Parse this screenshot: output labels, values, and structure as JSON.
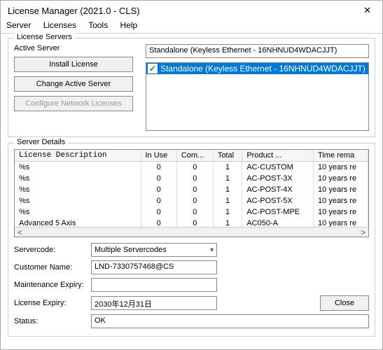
{
  "window": {
    "title": "License Manager (2021.0 - CLS)"
  },
  "menu": {
    "server": "Server",
    "licenses": "Licenses",
    "tools": "Tools",
    "help": "Help"
  },
  "servers_group": {
    "title": "License Servers",
    "active_label": "Active Server",
    "active_value": "Standalone (Keyless Ethernet - 16NHNUD4WDACJJT)",
    "install_btn": "Install License",
    "change_btn": "Change Active Server",
    "config_btn": "Configure Network Licenses",
    "list_item": "Standalone (Keyless Ethernet - 16NHNUD4WDACJJT)"
  },
  "details_group": {
    "title": "Server Details",
    "headers": {
      "desc": "License Description",
      "inuse": "In Use",
      "com": "Com...",
      "total": "Total",
      "product": "Product ...",
      "time": "Time rema"
    },
    "rows": [
      {
        "desc": "%s",
        "inuse": "0",
        "com": "0",
        "total": "1",
        "product": "AC-CUSTOM",
        "time": "10 years re"
      },
      {
        "desc": "%s",
        "inuse": "0",
        "com": "0",
        "total": "1",
        "product": "AC-POST-3X",
        "time": "10 years re"
      },
      {
        "desc": "%s",
        "inuse": "0",
        "com": "0",
        "total": "1",
        "product": "AC-POST-4X",
        "time": "10 years re"
      },
      {
        "desc": "%s",
        "inuse": "0",
        "com": "0",
        "total": "1",
        "product": "AC-POST-5X",
        "time": "10 years re"
      },
      {
        "desc": "%s",
        "inuse": "0",
        "com": "0",
        "total": "1",
        "product": "AC-POST-MPE",
        "time": "10 years re"
      },
      {
        "desc": "Advanced 5 Axis",
        "inuse": "0",
        "com": "0",
        "total": "1",
        "product": "AC050-A",
        "time": "10 years re"
      }
    ]
  },
  "form": {
    "servercode_label": "Servercode:",
    "servercode_value": "Multiple Servercodes",
    "customer_label": "Customer Name:",
    "customer_value": "LND-7330757468@CS",
    "maint_label": "Maintenance Expiry:",
    "maint_value": "",
    "lic_label": "License Expiry:",
    "lic_value": "2030年12月31日",
    "status_label": "Status:",
    "status_value": "OK",
    "close_btn": "Close"
  }
}
